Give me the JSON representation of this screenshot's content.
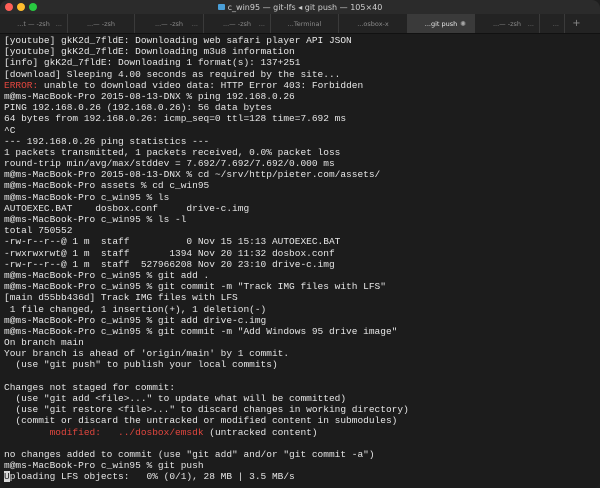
{
  "window": {
    "title": "c_win95 — git-lfs ◂ git push — 105×40",
    "folder_icon": "folder-icon"
  },
  "tabs": [
    {
      "label": "...t — -zsh",
      "more": "..."
    },
    {
      "label": "...— -zsh",
      "more": ""
    },
    {
      "label": "...— -zsh",
      "more": "..."
    },
    {
      "label": "...— -zsh",
      "more": "..."
    },
    {
      "label": "...Terminal",
      "more": ""
    },
    {
      "label": "...osbox-x",
      "more": ""
    },
    {
      "label": "...git push",
      "more": "",
      "active": true
    },
    {
      "label": "...— -zsh",
      "more": "..."
    },
    {
      "label": "",
      "more": "..."
    }
  ],
  "new_tab": "+",
  "terminal": {
    "lines": [
      "[youtube] gkK2d_7fldE: Downloading web safari player API JSON",
      "[youtube] gkK2d_7fldE: Downloading m3u8 information",
      "[info] gkK2d_7fldE: Downloading 1 format(s): 137+251",
      "[download] Sleeping 4.00 seconds as required by the site...",
      {
        "red": "ERROR:",
        "rest": " unable to download video data: HTTP Error 403: Forbidden"
      },
      "m@ms-MacBook-Pro 2015-08-13-DNX % ping 192.168.0.26",
      "PING 192.168.0.26 (192.168.0.26): 56 data bytes",
      "64 bytes from 192.168.0.26: icmp_seq=0 ttl=128 time=7.692 ms",
      "^C",
      "--- 192.168.0.26 ping statistics ---",
      "1 packets transmitted, 1 packets received, 0.0% packet loss",
      "round-trip min/avg/max/stddev = 7.692/7.692/7.692/0.000 ms",
      "m@ms-MacBook-Pro 2015-08-13-DNX % cd ~/srv/http/pieter.com/assets/",
      "m@ms-MacBook-Pro assets % cd c_win95",
      "m@ms-MacBook-Pro c_win95 % ls",
      "AUTOEXEC.BAT    dosbox.conf     drive-c.img",
      "m@ms-MacBook-Pro c_win95 % ls -l",
      "total 750552",
      "-rw-r--r--@ 1 m  staff          0 Nov 15 15:13 AUTOEXEC.BAT",
      "-rwxrwxrwt@ 1 m  staff       1394 Nov 20 11:32 dosbox.conf",
      "-rw-r--r--@ 1 m  staff  527966208 Nov 20 23:10 drive-c.img",
      "m@ms-MacBook-Pro c_win95 % git add .",
      "m@ms-MacBook-Pro c_win95 % git commit -m \"Track IMG files with LFS\"",
      "[main d55bb436d] Track IMG files with LFS",
      " 1 file changed, 1 insertion(+), 1 deletion(-)",
      "m@ms-MacBook-Pro c_win95 % git add drive-c.img",
      "m@ms-MacBook-Pro c_win95 % git commit -m \"Add Windows 95 drive image\"",
      "On branch main",
      "Your branch is ahead of 'origin/main' by 1 commit.",
      "  (use \"git push\" to publish your local commits)",
      "",
      "Changes not staged for commit:",
      "  (use \"git add <file>...\" to update what will be committed)",
      "  (use \"git restore <file>...\" to discard changes in working directory)",
      "  (commit or discard the untracked or modified content in submodules)",
      {
        "pre": "\t",
        "red": "modified:   ../dosbox/emsdk",
        "rest": " (untracked content)"
      },
      "",
      "no changes added to commit (use \"git add\" and/or \"git commit -a\")",
      "m@ms-MacBook-Pro c_win95 % git push",
      {
        "cursor": "U",
        "rest": "ploading LFS objects:   0% (0/1), 28 MB | 3.5 MB/s"
      }
    ]
  },
  "colors": {
    "error": "#e0463e",
    "close": "#ff5f57",
    "minimize": "#febc2e",
    "zoom": "#28c840"
  }
}
